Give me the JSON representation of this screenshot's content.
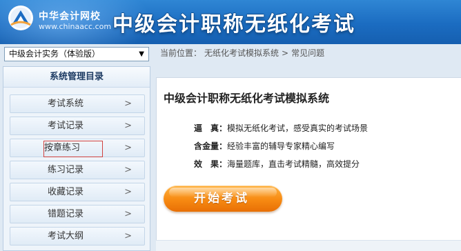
{
  "header": {
    "logo_name": "中华会计网校",
    "logo_url": "www.chinaacc.com",
    "title": "中级会计职称无纸化考试"
  },
  "sidebar": {
    "subject_select": "中级会计实务（体验版）",
    "title": "系统管理目录",
    "items": [
      {
        "label": "考试系统"
      },
      {
        "label": "考试记录"
      },
      {
        "label": "按章练习"
      },
      {
        "label": "练习记录"
      },
      {
        "label": "收藏记录"
      },
      {
        "label": "错题记录"
      },
      {
        "label": "考试大纲"
      }
    ],
    "chevron": ">"
  },
  "breadcrumb": {
    "prefix": "当前位置：",
    "items": [
      "无纸化考试模拟系统",
      "常见问题"
    ],
    "separator": ">"
  },
  "main": {
    "title": "中级会计职称无纸化考试模拟系统",
    "features": [
      {
        "term": "逼　真：",
        "desc": "模拟无纸化考试，感受真实的考试场景"
      },
      {
        "term": "含金量：",
        "desc": "经验丰富的辅导专家精心编写"
      },
      {
        "term": "效　果：",
        "desc": "海量题库，直击考试精髓，高效提分"
      }
    ],
    "start_button": "开始考试"
  },
  "colors": {
    "header_blue": "#1b6cc1",
    "button_orange": "#f78a12",
    "highlight_red": "#d0413e"
  }
}
